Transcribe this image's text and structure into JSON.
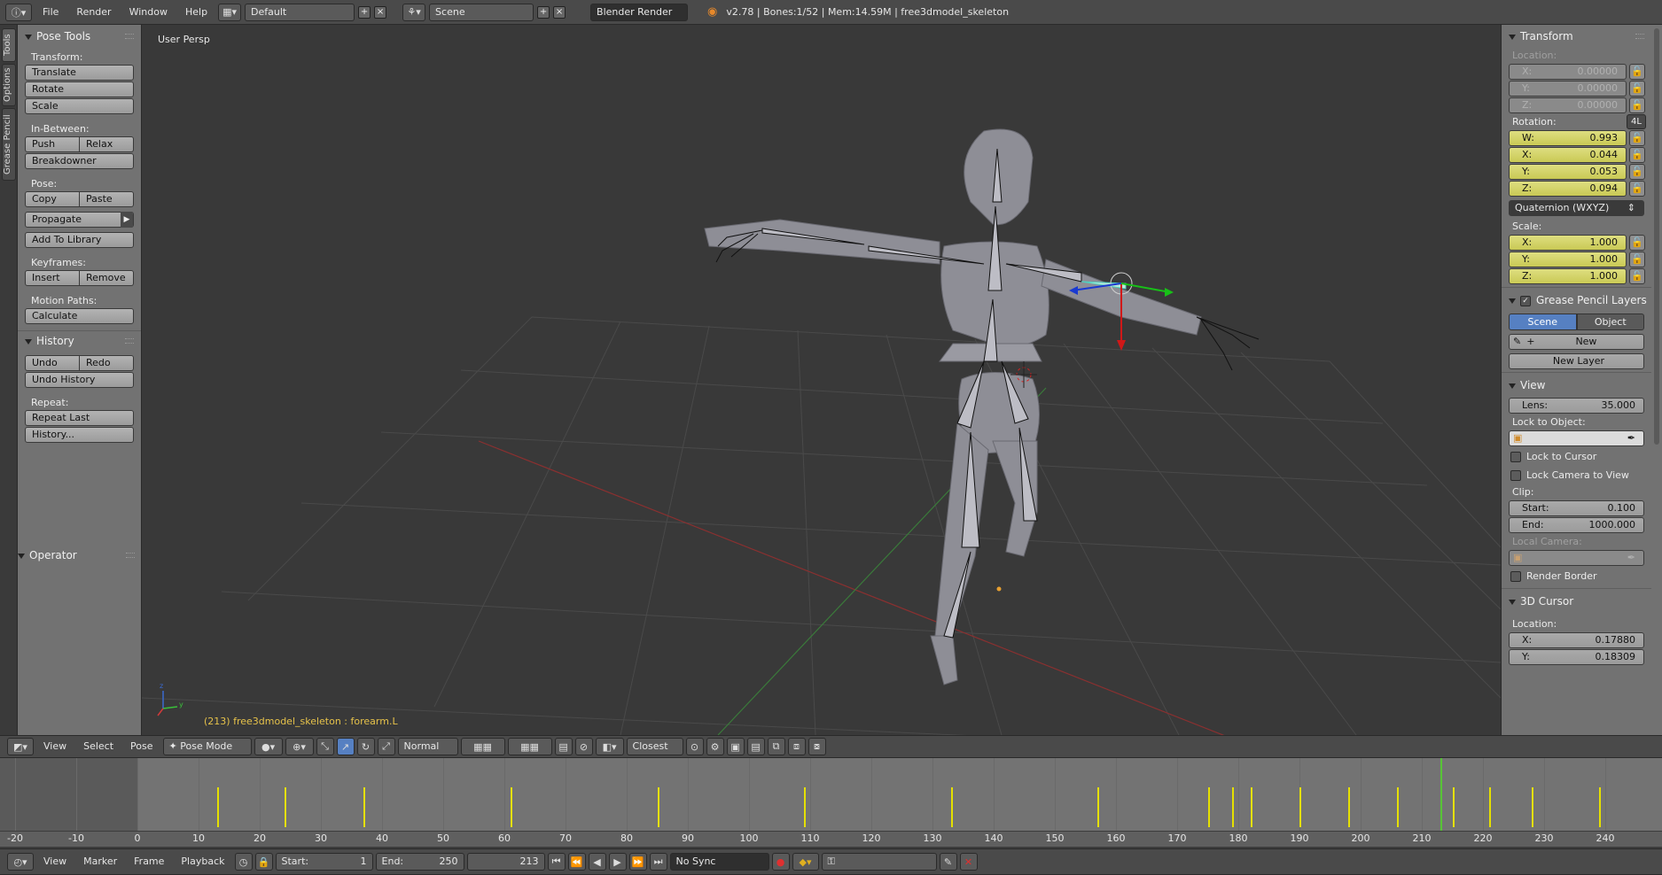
{
  "topbar": {
    "menus": [
      "File",
      "Render",
      "Window",
      "Help"
    ],
    "screen_layout": "Default",
    "scene": "Scene",
    "render_engine": "Blender Render",
    "stats": "v2.78 | Bones:1/52 | Mem:14.59M | free3dmodel_skeleton"
  },
  "left_tabs": [
    "Tools",
    "Options",
    "Grease Pencil"
  ],
  "toolshelf": {
    "pose_tools": {
      "title": "Pose Tools",
      "transform_label": "Transform:",
      "translate": "Translate",
      "rotate": "Rotate",
      "scale": "Scale",
      "inbetween_label": "In-Between:",
      "push": "Push",
      "relax": "Relax",
      "breakdowner": "Breakdowner",
      "pose_label": "Pose:",
      "copy": "Copy",
      "paste": "Paste",
      "propagate": "Propagate",
      "add_to_library": "Add To Library",
      "keyframes_label": "Keyframes:",
      "insert": "Insert",
      "remove": "Remove",
      "motion_paths_label": "Motion Paths:",
      "calculate": "Calculate"
    },
    "history": {
      "title": "History",
      "undo": "Undo",
      "redo": "Redo",
      "undo_history": "Undo History",
      "repeat_label": "Repeat:",
      "repeat_last": "Repeat Last",
      "history_dots": "History..."
    },
    "operator": {
      "title": "Operator"
    }
  },
  "viewport": {
    "view_name": "User Persp",
    "active_object": "(213) free3dmodel_skeleton : forearm.L"
  },
  "view3d_header": {
    "view": "View",
    "select": "Select",
    "pose": "Pose",
    "mode": "Pose Mode",
    "orientation": "Normal",
    "snap": "Closest"
  },
  "properties": {
    "transform": {
      "title": "Transform",
      "location_label": "Location:",
      "location": [
        {
          "axis": "X:",
          "value": "0.00000"
        },
        {
          "axis": "Y:",
          "value": "0.00000"
        },
        {
          "axis": "Z:",
          "value": "0.00000"
        }
      ],
      "rotation_label": "Rotation:",
      "rotation_mode_btn": "4L",
      "rotation": [
        {
          "axis": "W:",
          "value": "0.993"
        },
        {
          "axis": "X:",
          "value": "0.044"
        },
        {
          "axis": "Y:",
          "value": "0.053"
        },
        {
          "axis": "Z:",
          "value": "0.094"
        }
      ],
      "rotation_mode": "Quaternion (WXYZ)",
      "scale_label": "Scale:",
      "scale": [
        {
          "axis": "X:",
          "value": "1.000"
        },
        {
          "axis": "Y:",
          "value": "1.000"
        },
        {
          "axis": "Z:",
          "value": "1.000"
        }
      ]
    },
    "grease_pencil": {
      "title": "Grease Pencil Layers",
      "scene": "Scene",
      "object": "Object",
      "new": "New",
      "new_layer": "New Layer"
    },
    "view": {
      "title": "View",
      "lens_label": "Lens:",
      "lens_value": "35.000",
      "lock_to_object": "Lock to Object:",
      "lock_to_cursor": "Lock to Cursor",
      "lock_camera_to_view": "Lock Camera to View",
      "clip_label": "Clip:",
      "clip_start_label": "Start:",
      "clip_start": "0.100",
      "clip_end_label": "End:",
      "clip_end": "1000.000",
      "local_camera": "Local Camera:",
      "render_border": "Render Border"
    },
    "cursor": {
      "title": "3D Cursor",
      "location_label": "Location:",
      "x_label": "X:",
      "x_value": "0.17880",
      "y_label": "Y:",
      "y_value": "0.18309"
    }
  },
  "timeline": {
    "tick_labels": [
      "-20",
      "-10",
      "0",
      "10",
      "20",
      "30",
      "40",
      "50",
      "60",
      "70",
      "80",
      "90",
      "100",
      "110",
      "120",
      "130",
      "140",
      "150",
      "160",
      "170",
      "180",
      "190",
      "200",
      "210",
      "220",
      "230",
      "240"
    ],
    "tick_values": [
      -20,
      -10,
      0,
      10,
      20,
      30,
      40,
      50,
      60,
      70,
      80,
      90,
      100,
      110,
      120,
      130,
      140,
      150,
      160,
      170,
      180,
      190,
      200,
      210,
      220,
      230,
      240
    ],
    "keyframes": [
      13,
      24,
      37,
      61,
      85,
      109,
      133,
      157,
      175,
      179,
      182,
      190,
      198,
      206,
      215,
      221,
      228,
      239
    ],
    "current_frame_value": 213
  },
  "timeline_header": {
    "view": "View",
    "marker": "Marker",
    "frame": "Frame",
    "playback": "Playback",
    "start_label": "Start:",
    "start": "1",
    "end_label": "End:",
    "end": "250",
    "current_frame": "213",
    "sync": "No Sync"
  },
  "colors": {
    "keyframe": "#e5e000",
    "current_frame": "#57c436",
    "active_tab": "#5680c2",
    "yellow_field": "#d4d46a"
  }
}
